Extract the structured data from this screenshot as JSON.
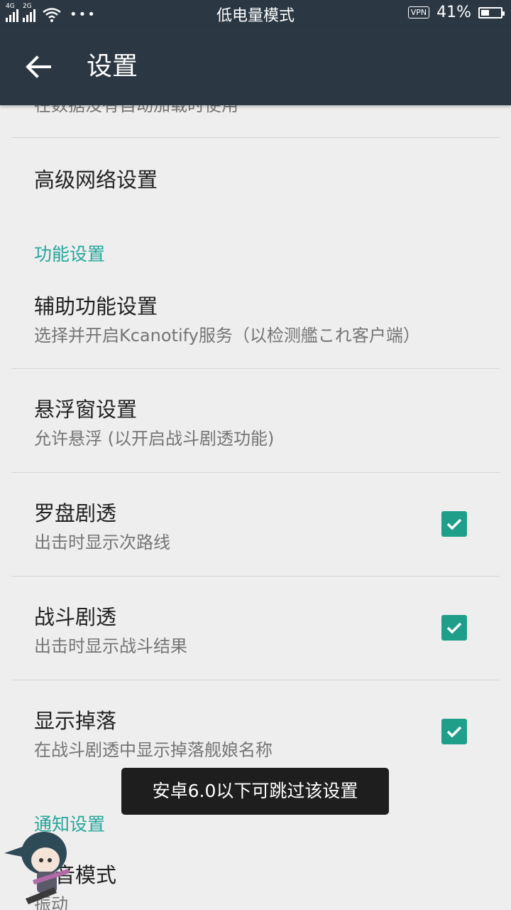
{
  "status_bar": {
    "signal1_label": "4G",
    "signal2_label": "2G",
    "more_dots": "•••",
    "mode_text": "低电量模式",
    "vpn": "VPN",
    "battery_percent": "41%",
    "battery_level": 0.41
  },
  "app_bar": {
    "title": "设置"
  },
  "prefs": {
    "partial_summary": "在数据没有自动加载时使用",
    "advanced_network": {
      "title": "高级网络设置"
    },
    "category_features": "功能设置",
    "accessibility": {
      "title": "辅助功能设置",
      "summary": "选择并开启Kcanotify服务（以检测艦これ客户端）"
    },
    "floating_window": {
      "title": "悬浮窗设置",
      "summary": "允许悬浮 (以开启战斗剧透功能)"
    },
    "compass_spoiler": {
      "title": "罗盘剧透",
      "summary": "出击时显示次路线",
      "checked": true
    },
    "battle_spoiler": {
      "title": "战斗剧透",
      "summary": "出击时显示战斗结果",
      "checked": true
    },
    "show_drops": {
      "title": "显示掉落",
      "summary": "在战斗剧透中显示掉落舰娘名称",
      "checked": true
    },
    "category_notifications": "通知设置",
    "sound_mode": {
      "title": "声音模式",
      "summary": "振动"
    }
  },
  "toast": {
    "text": "安卓6.0以下可跳过该设置"
  },
  "colors": {
    "appbar": "#2b3844",
    "accent": "#26a69a",
    "checkbox": "#1f9e89",
    "background": "#eeeeee"
  }
}
